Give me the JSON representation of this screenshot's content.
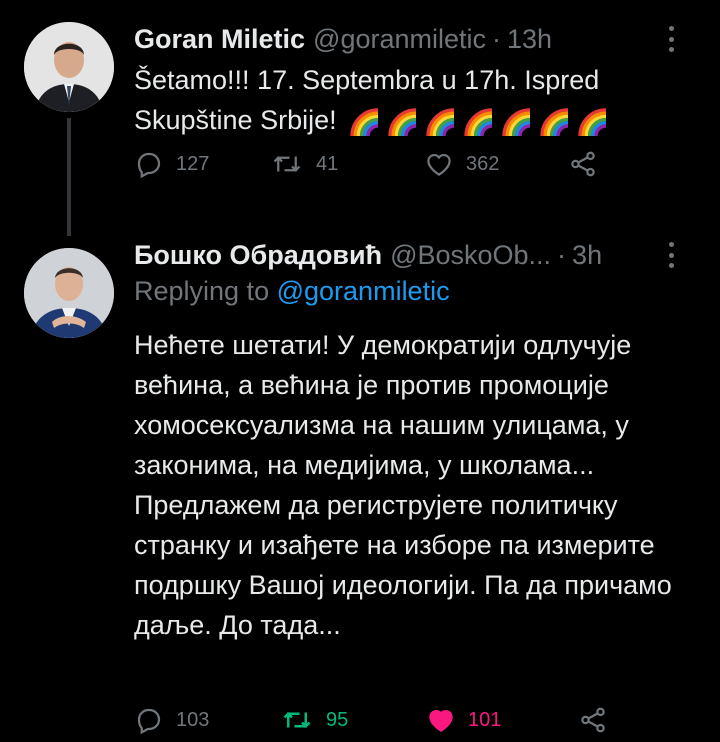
{
  "colors": {
    "background": "#000000",
    "text": "#e7e9ea",
    "muted": "#71767b",
    "link": "#1d9bf0",
    "retweet_active": "#00ba7c",
    "like_active": "#f91880"
  },
  "tweets": [
    {
      "name": "Goran Miletic",
      "handle": "@goranmiletic",
      "separator": "·",
      "time": "13h",
      "text": "Šetamo!!! 17. Septembra u 17h. Ispred Skupštine Srbije!",
      "emoji": [
        "rainbow-icon",
        "rainbow-icon",
        "rainbow-icon",
        "rainbow-icon",
        "rainbow-icon",
        "rainbow-icon",
        "rainbow-icon"
      ],
      "replies": "127",
      "retweets": "41",
      "likes": "362",
      "icons": [
        "reply-icon",
        "retweet-icon",
        "like-icon",
        "share-icon"
      ]
    },
    {
      "name": "Бошко Обрадовић",
      "handle": "@BoskoOb...",
      "separator": "·",
      "time": "3h",
      "replying_prefix": "Replying to",
      "replying_to": "@goranmiletic",
      "text": "Нећете шетати! У демократији одлучује већина, а већина је против промоције хомосексуализма на нашим улицама, у законима, на медијима, у школама... Предлажем да региструјете политичку странку и изађете на изборе па измерите подршку Вашој идеологији. Па да причамо даље. До тада...",
      "replies": "103",
      "retweets": "95",
      "likes": "101",
      "retweeted": true,
      "liked": true,
      "icons": [
        "reply-icon",
        "retweet-icon",
        "like-icon",
        "share-icon"
      ]
    }
  ]
}
